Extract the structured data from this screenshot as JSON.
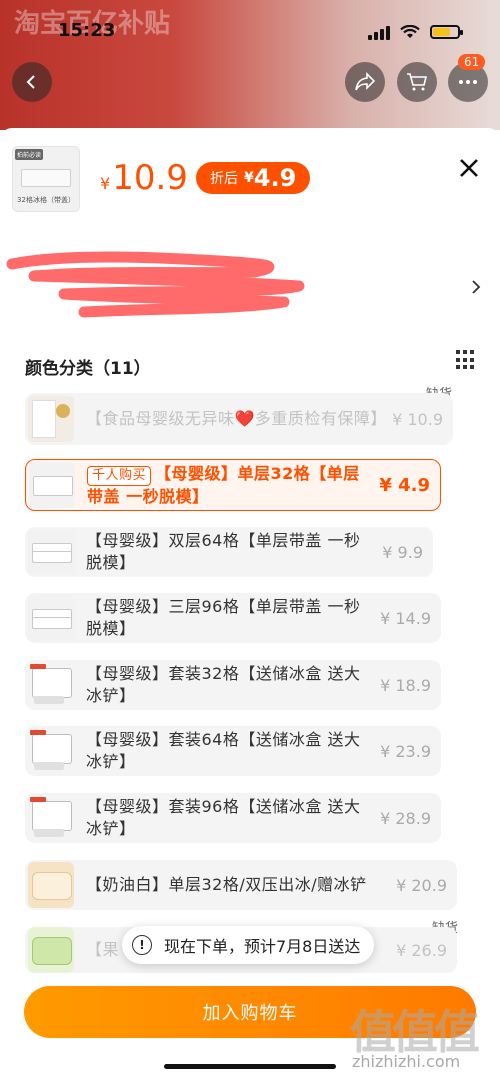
{
  "status": {
    "time": "15:23"
  },
  "header": {
    "banner_text": "淘宝百亿补贴",
    "cart_badge": "61"
  },
  "product": {
    "currency": "¥",
    "price": "10.9",
    "after_discount_label": "折后",
    "after_discount_price": "4.9",
    "thumb_caption": "32格冰格（带盖）",
    "thumb_tag": "拍前必读"
  },
  "variants": {
    "title": "颜色分类（11）",
    "out_of_stock_label": "缺货",
    "items": [
      {
        "label": "【食品母婴级无异味❤️多重质检有保障】",
        "price": "¥ 10.9",
        "disabled": true
      },
      {
        "chip": "千人购买",
        "label": "【母婴级】单层32格【单层带盖 一秒脱模】",
        "price": "¥ 4.9",
        "selected": true
      },
      {
        "label": "【母婴级】双层64格【单层带盖 一秒脱模】",
        "price": "¥ 9.9"
      },
      {
        "label": "【母婴级】三层96格【单层带盖 一秒脱模】",
        "price": "¥ 14.9"
      },
      {
        "label": "【母婴级】套装32格【送储冰盒 送大冰铲】",
        "price": "¥ 18.9"
      },
      {
        "label": "【母婴级】套装64格【送储冰盒 送大冰铲】",
        "price": "¥ 23.9"
      },
      {
        "label": "【母婴级】套装96格【送储冰盒 送大冰铲】",
        "price": "¥ 28.9"
      },
      {
        "label": "【奶油白】单层32格/双压出冰/赠冰铲",
        "price": "¥ 20.9"
      },
      {
        "label": "【果 铲",
        "price": "¥ 26.9",
        "disabled": true
      }
    ]
  },
  "toast": {
    "text": "现在下单，预计7月8日送达"
  },
  "actions": {
    "add_to_cart": "加入购物车"
  },
  "watermark": {
    "logo": "值值值",
    "url": "zhizhizhi.com"
  },
  "colors": {
    "accent": "#ff5000",
    "button": "#ff8a00"
  }
}
